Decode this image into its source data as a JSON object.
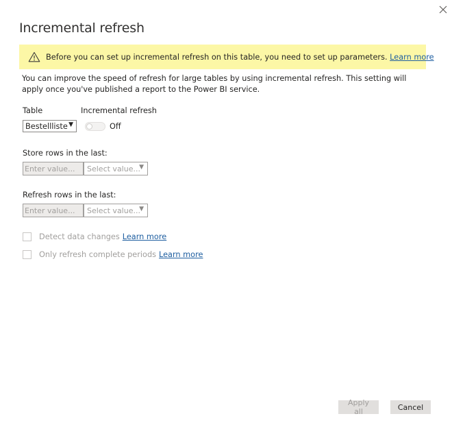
{
  "dialog": {
    "title": "Incremental refresh"
  },
  "warning": {
    "icon": "warning-icon",
    "text": "Before you can set up incremental refresh on this table, you need to set up parameters.",
    "link": "Learn more",
    "background": "#fcf7a6"
  },
  "description": "You can improve the speed of refresh for large tables by using incremental refresh. This setting will apply once you've published a report to the Power BI service.",
  "table": {
    "label": "Table",
    "selected": "Bestellliste"
  },
  "incremental": {
    "label": "Incremental refresh",
    "state": "Off"
  },
  "store": {
    "label": "Store rows in the last:",
    "value_placeholder": "Enter value...",
    "unit_placeholder": "Select value..."
  },
  "refresh": {
    "label": "Refresh rows in the last:",
    "value_placeholder": "Enter value...",
    "unit_placeholder": "Select value..."
  },
  "options": {
    "detect_label": "Detect data changes",
    "detect_link": "Learn more",
    "complete_label": "Only refresh complete periods",
    "complete_link": "Learn more"
  },
  "buttons": {
    "apply": "Apply all",
    "cancel": "Cancel"
  },
  "colors": {
    "link": "#1e5ea0",
    "disabled_text": "#a19f9d"
  }
}
